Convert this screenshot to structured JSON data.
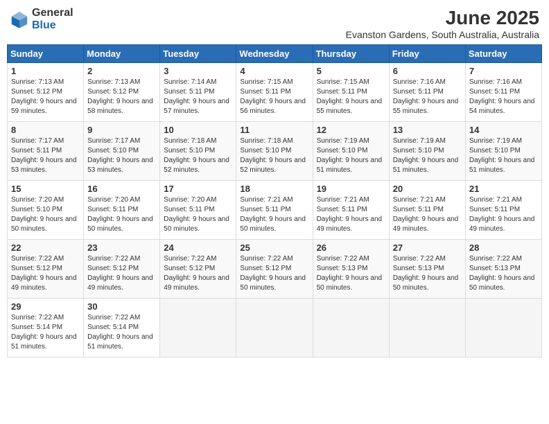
{
  "header": {
    "logo_general": "General",
    "logo_blue": "Blue",
    "month_title": "June 2025",
    "location": "Evanston Gardens, South Australia, Australia"
  },
  "days_of_week": [
    "Sunday",
    "Monday",
    "Tuesday",
    "Wednesday",
    "Thursday",
    "Friday",
    "Saturday"
  ],
  "weeks": [
    [
      {
        "num": "1",
        "sunrise": "7:13 AM",
        "sunset": "5:12 PM",
        "daylight": "9 hours and 59 minutes."
      },
      {
        "num": "2",
        "sunrise": "7:13 AM",
        "sunset": "5:12 PM",
        "daylight": "9 hours and 58 minutes."
      },
      {
        "num": "3",
        "sunrise": "7:14 AM",
        "sunset": "5:11 PM",
        "daylight": "9 hours and 57 minutes."
      },
      {
        "num": "4",
        "sunrise": "7:15 AM",
        "sunset": "5:11 PM",
        "daylight": "9 hours and 56 minutes."
      },
      {
        "num": "5",
        "sunrise": "7:15 AM",
        "sunset": "5:11 PM",
        "daylight": "9 hours and 55 minutes."
      },
      {
        "num": "6",
        "sunrise": "7:16 AM",
        "sunset": "5:11 PM",
        "daylight": "9 hours and 55 minutes."
      },
      {
        "num": "7",
        "sunrise": "7:16 AM",
        "sunset": "5:11 PM",
        "daylight": "9 hours and 54 minutes."
      }
    ],
    [
      {
        "num": "8",
        "sunrise": "7:17 AM",
        "sunset": "5:11 PM",
        "daylight": "9 hours and 53 minutes."
      },
      {
        "num": "9",
        "sunrise": "7:17 AM",
        "sunset": "5:10 PM",
        "daylight": "9 hours and 53 minutes."
      },
      {
        "num": "10",
        "sunrise": "7:18 AM",
        "sunset": "5:10 PM",
        "daylight": "9 hours and 52 minutes."
      },
      {
        "num": "11",
        "sunrise": "7:18 AM",
        "sunset": "5:10 PM",
        "daylight": "9 hours and 52 minutes."
      },
      {
        "num": "12",
        "sunrise": "7:19 AM",
        "sunset": "5:10 PM",
        "daylight": "9 hours and 51 minutes."
      },
      {
        "num": "13",
        "sunrise": "7:19 AM",
        "sunset": "5:10 PM",
        "daylight": "9 hours and 51 minutes."
      },
      {
        "num": "14",
        "sunrise": "7:19 AM",
        "sunset": "5:10 PM",
        "daylight": "9 hours and 51 minutes."
      }
    ],
    [
      {
        "num": "15",
        "sunrise": "7:20 AM",
        "sunset": "5:10 PM",
        "daylight": "9 hours and 50 minutes."
      },
      {
        "num": "16",
        "sunrise": "7:20 AM",
        "sunset": "5:11 PM",
        "daylight": "9 hours and 50 minutes."
      },
      {
        "num": "17",
        "sunrise": "7:20 AM",
        "sunset": "5:11 PM",
        "daylight": "9 hours and 50 minutes."
      },
      {
        "num": "18",
        "sunrise": "7:21 AM",
        "sunset": "5:11 PM",
        "daylight": "9 hours and 50 minutes."
      },
      {
        "num": "19",
        "sunrise": "7:21 AM",
        "sunset": "5:11 PM",
        "daylight": "9 hours and 49 minutes."
      },
      {
        "num": "20",
        "sunrise": "7:21 AM",
        "sunset": "5:11 PM",
        "daylight": "9 hours and 49 minutes."
      },
      {
        "num": "21",
        "sunrise": "7:21 AM",
        "sunset": "5:11 PM",
        "daylight": "9 hours and 49 minutes."
      }
    ],
    [
      {
        "num": "22",
        "sunrise": "7:22 AM",
        "sunset": "5:12 PM",
        "daylight": "9 hours and 49 minutes."
      },
      {
        "num": "23",
        "sunrise": "7:22 AM",
        "sunset": "5:12 PM",
        "daylight": "9 hours and 49 minutes."
      },
      {
        "num": "24",
        "sunrise": "7:22 AM",
        "sunset": "5:12 PM",
        "daylight": "9 hours and 49 minutes."
      },
      {
        "num": "25",
        "sunrise": "7:22 AM",
        "sunset": "5:12 PM",
        "daylight": "9 hours and 50 minutes."
      },
      {
        "num": "26",
        "sunrise": "7:22 AM",
        "sunset": "5:13 PM",
        "daylight": "9 hours and 50 minutes."
      },
      {
        "num": "27",
        "sunrise": "7:22 AM",
        "sunset": "5:13 PM",
        "daylight": "9 hours and 50 minutes."
      },
      {
        "num": "28",
        "sunrise": "7:22 AM",
        "sunset": "5:13 PM",
        "daylight": "9 hours and 50 minutes."
      }
    ],
    [
      {
        "num": "29",
        "sunrise": "7:22 AM",
        "sunset": "5:14 PM",
        "daylight": "9 hours and 51 minutes."
      },
      {
        "num": "30",
        "sunrise": "7:22 AM",
        "sunset": "5:14 PM",
        "daylight": "9 hours and 51 minutes."
      },
      null,
      null,
      null,
      null,
      null
    ]
  ]
}
